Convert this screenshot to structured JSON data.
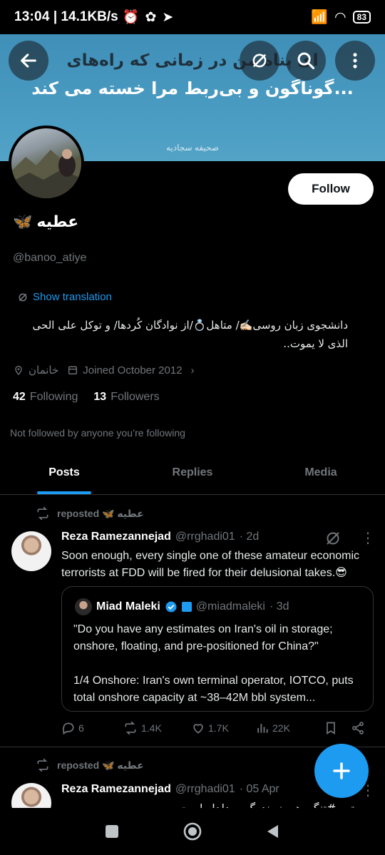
{
  "status_bar": {
    "time": "13:04",
    "speed": "14.1KB/s",
    "battery": "83"
  },
  "banner": {
    "line1": "ای پناه من در زمانی که راه‌های",
    "line2": "گوناگون و بی‌ربط مرا خسته می کند...",
    "caption": "صحیفه سجادیه"
  },
  "profile": {
    "name": "عطیه",
    "handle": "@banoo_atiye",
    "show_translation": "Show translation",
    "bio": "دانشجوی زبان روسی✍🏻/ متاهل💍/از نوادگان کُردها/ و توکل علی الحی الذی لا یموت..",
    "location": "خانمان",
    "joined": "Joined October 2012",
    "following_count": "42",
    "following_label": "Following",
    "followers_count": "13",
    "followers_label": "Followers",
    "not_followed": "Not followed by anyone you’re following",
    "follow_label": "Follow"
  },
  "tabs": [
    {
      "label": "Posts"
    },
    {
      "label": "Replies"
    },
    {
      "label": "Media"
    }
  ],
  "posts": [
    {
      "reposted": "reposted 🦋 عطیه",
      "author": "Reza Ramezannejad",
      "handle": "@rrghadi01",
      "time": "· 2d",
      "text": "Soon enough, every single one of these amateur economic terrorists at FDD will be fired for their delusional takes.😎",
      "quote": {
        "author": "Miad Maleki",
        "handle": "@miadmaleki",
        "time": "· 3d",
        "text1": "\"Do you have any estimates on Iran's oil in storage; onshore, floating, and pre-positioned for China?\"",
        "text2": "1/4 Onshore: Iran's own terminal operator, IOTCO, puts total onshore capacity at ~38–42M bbl system..."
      },
      "replies": "6",
      "reposts": "1.4K",
      "likes": "1.7K",
      "views": "22K"
    },
    {
      "reposted": "reposted 🦋 عطیه",
      "author": "Reza Ramezannejad",
      "handle": "@rrghadi01",
      "time": "· 05 Apr",
      "text": "...ستور #تنگه_هرمز بندرگوپ دلدار است"
    }
  ],
  "colors": {
    "accent": "#1d9bf0",
    "background": "#000000",
    "muted": "#71767b"
  }
}
